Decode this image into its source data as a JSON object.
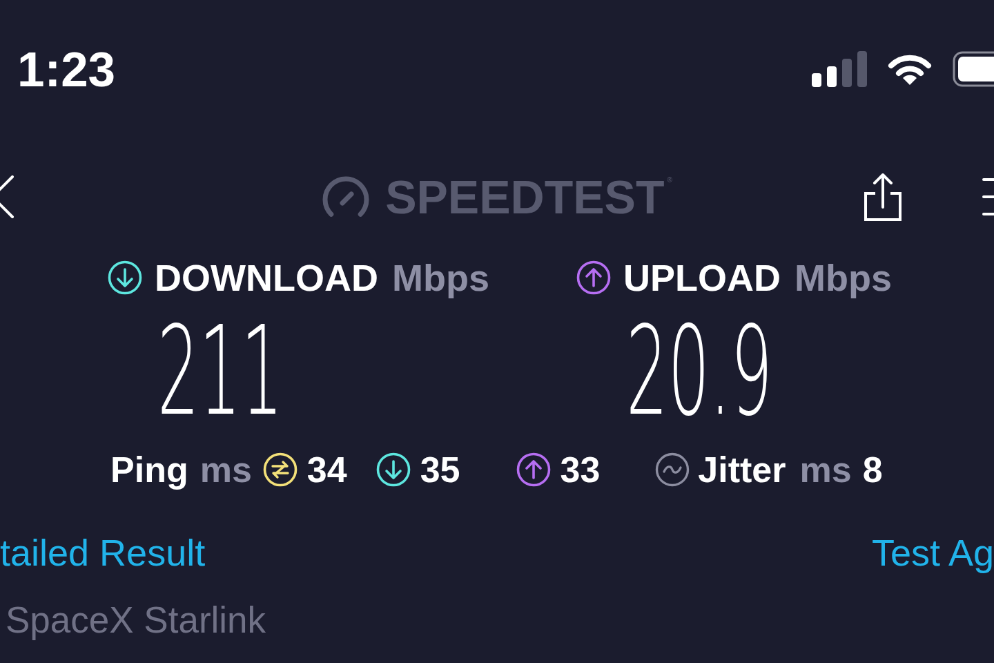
{
  "status_bar": {
    "time": "1:23"
  },
  "nav": {
    "logo": {
      "text": "SPEEDTEST",
      "mark": "®"
    }
  },
  "results": [
    {
      "kind": "download",
      "label": "DOWNLOAD",
      "unit": "Mbps",
      "value": "211",
      "color": "#5de6df"
    },
    {
      "kind": "upload",
      "label": "UPLOAD",
      "unit": "Mbps",
      "value": "20.9",
      "color": "#b66ef2"
    }
  ],
  "latency": {
    "label": "Ping",
    "unit": "ms",
    "readings": [
      {
        "kind": "idle",
        "value": "34",
        "color": "#f3e079"
      },
      {
        "kind": "download",
        "value": "35",
        "color": "#5de6df"
      },
      {
        "kind": "upload",
        "value": "33",
        "color": "#b66ef2"
      }
    ],
    "jitter": {
      "label": "Jitter",
      "unit": "ms",
      "value": "8"
    }
  },
  "links": [
    {
      "label": "tailed Result"
    },
    {
      "label": "Test Ag"
    }
  ],
  "provider": "SpaceX Starlink"
}
